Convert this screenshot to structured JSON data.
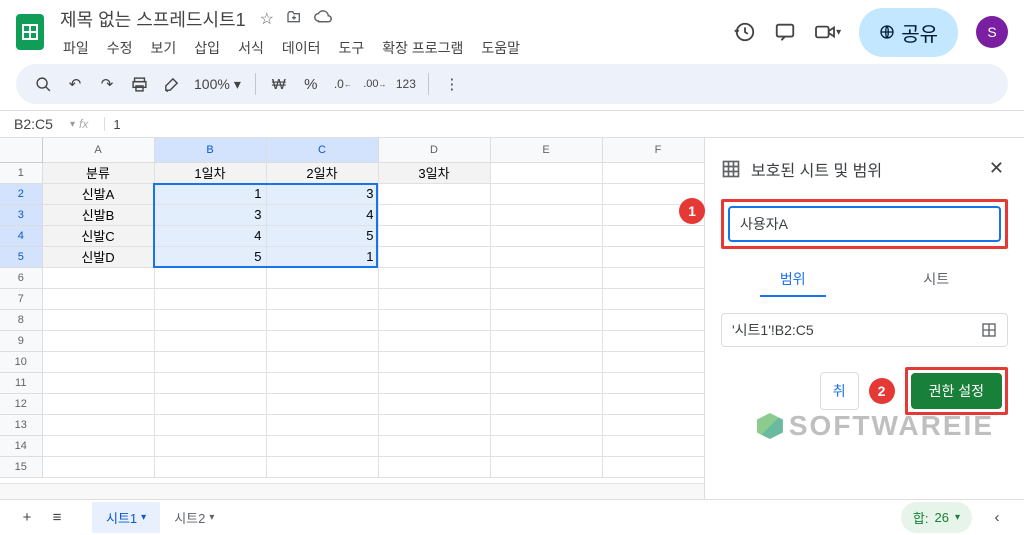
{
  "doc": {
    "title": "제목 없는 스프레드시트1"
  },
  "menu": {
    "file": "파일",
    "edit": "수정",
    "view": "보기",
    "insert": "삽입",
    "format": "서식",
    "data": "데이터",
    "tools": "도구",
    "extensions": "확장 프로그램",
    "help": "도움말"
  },
  "toolbar": {
    "zoom": "100%",
    "currency": "₩",
    "percent": "%",
    "dec_dec": ".0",
    "dec_inc": ".00",
    "format123": "123"
  },
  "share": {
    "label": "공유"
  },
  "avatar": {
    "letter": "S"
  },
  "namebox": {
    "value": "B2:C5"
  },
  "formula": {
    "value": "1"
  },
  "grid": {
    "cols": [
      "A",
      "B",
      "C",
      "D",
      "E",
      "F"
    ],
    "headers": {
      "a": "분류",
      "b": "1일차",
      "c": "2일차",
      "d": "3일차"
    },
    "rows": [
      {
        "a": "신발A",
        "b": "1",
        "c": "3"
      },
      {
        "a": "신발B",
        "b": "3",
        "c": "4"
      },
      {
        "a": "신발C",
        "b": "4",
        "c": "5"
      },
      {
        "a": "신발D",
        "b": "5",
        "c": "1"
      }
    ]
  },
  "panel": {
    "title": "보호된 시트 및 범위",
    "desc": "사용자A",
    "tabs": {
      "range": "범위",
      "sheet": "시트"
    },
    "range_value": "'시트1'!B2:C5",
    "cancel": "취",
    "confirm": "권한 설정"
  },
  "sheets": {
    "s1": "시트1",
    "s2": "시트2"
  },
  "status": {
    "sum_label": "합:",
    "sum_value": "26"
  },
  "badges": {
    "one": "1",
    "two": "2"
  },
  "watermark": {
    "text": "SOFTWAREIE"
  }
}
